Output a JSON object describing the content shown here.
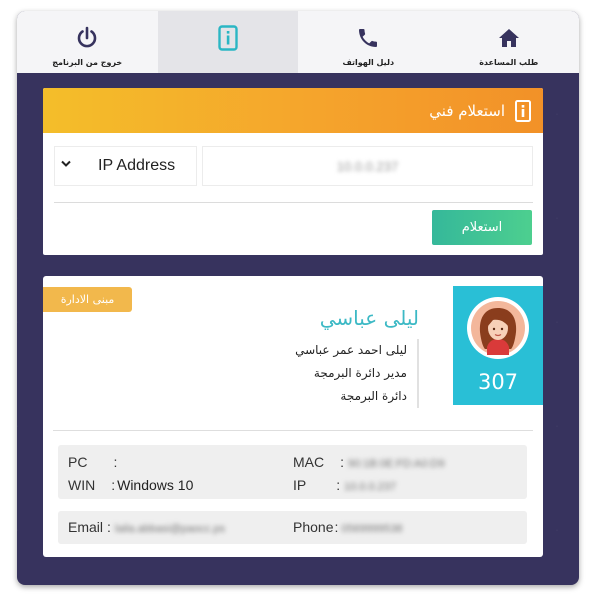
{
  "nav": {
    "exit_label": "خروج من البرنامج",
    "info_label": "",
    "phonebook_label": "دليل الهواتف",
    "help_label": "طلب المساعدة"
  },
  "inquiry": {
    "title": "استعلام فني",
    "type_selected": "IP Address",
    "ip_value": "10.0.0.237",
    "submit_label": "استعلام"
  },
  "profile": {
    "badge": "مبنى الادارة",
    "name": "ليلى عباسي",
    "full_name": "ليلى احمد عمر عباسي",
    "job_title": "مدير دائرة البرمجة",
    "department": "دائرة البرمجة",
    "extension": "307"
  },
  "system": {
    "pc_label": "PC",
    "pc_value": "",
    "win_label": "WIN",
    "win_value": "Windows 10",
    "mac_label": "MAC",
    "mac_value": "90:1B:0E:FD:A0:D9",
    "ip_label": "IP",
    "ip_value": "10.0.0.237",
    "sep": ":"
  },
  "contact": {
    "email_label": "Email",
    "email_value": "laila.abbasi@paocc.ps",
    "phone_label": "Phone",
    "phone_value": "0569999538",
    "sep": ":"
  },
  "colors": {
    "background": "#37335e",
    "header_gradient_start": "#f4be2a",
    "header_gradient_end": "#f29128",
    "submit_button": "#3dc496",
    "extension_box": "#29bfd6",
    "badge": "#f2b84c",
    "name_text": "#3cb9c5"
  }
}
